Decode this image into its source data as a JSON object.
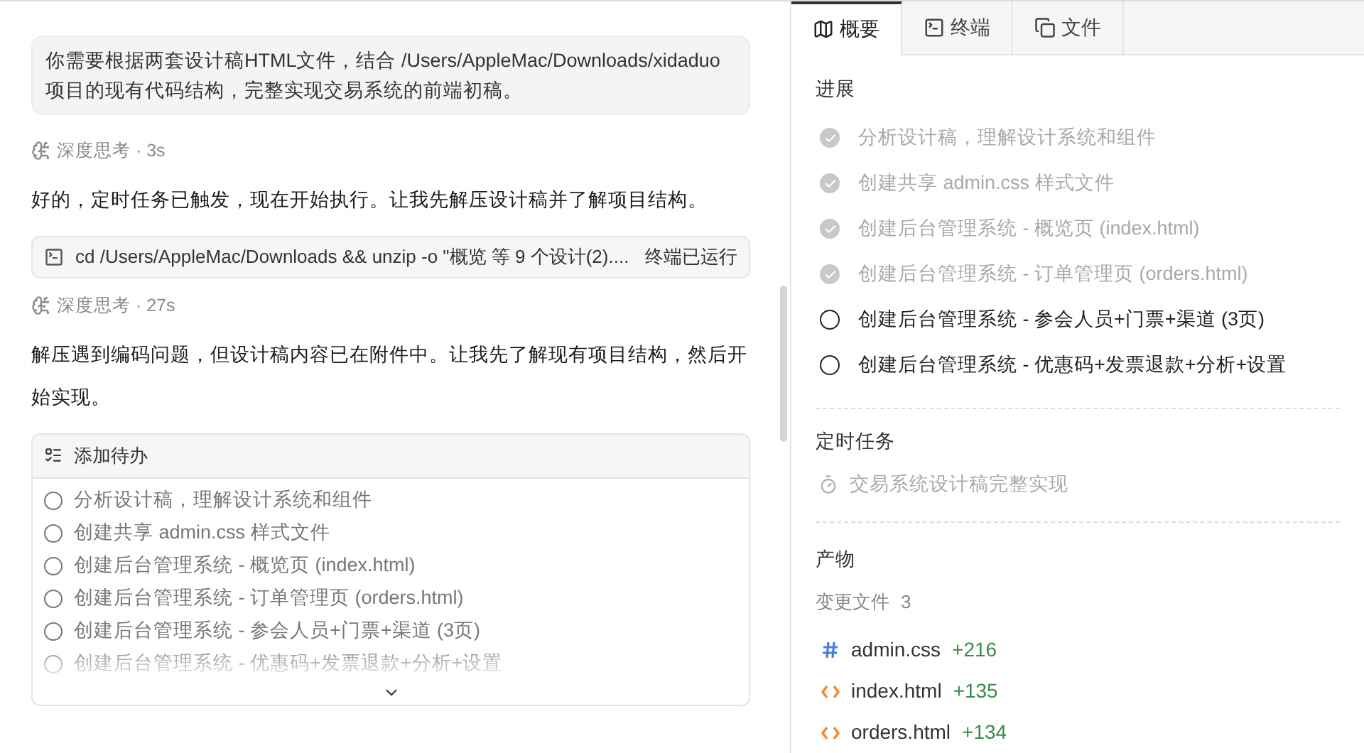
{
  "chat": {
    "user_message": "你需要根据两套设计稿HTML文件，结合 /Users/AppleMac/Downloads/xidaduo 项目的现有代码结构，完整实现交易系统的前端初稿。",
    "blocks": [
      {
        "kind": "thinking",
        "text": "深度思考 · 3s"
      },
      {
        "kind": "reply",
        "text": "好的，定时任务已触发，现在开始执行。让我先解压设计稿并了解项目结构。"
      },
      {
        "kind": "command",
        "text": "cd /Users/AppleMac/Downloads && unzip -o \"概览 等 9 个设计(2)....",
        "status": "终端已运行"
      },
      {
        "kind": "thinking",
        "text": "深度思考 · 27s"
      },
      {
        "kind": "reply",
        "text": "解压遇到编码问题，但设计稿内容已在附件中。让我先了解现有项目结构，然后开始实现。"
      }
    ],
    "todo": {
      "title": "添加待办",
      "items": [
        {
          "text": "分析设计稿，理解设计系统和组件",
          "checked": false
        },
        {
          "text": "创建共享 admin.css 样式文件",
          "checked": false
        },
        {
          "text": "创建后台管理系统 - 概览页 (index.html)",
          "checked": false
        },
        {
          "text": "创建后台管理系统 - 订单管理页 (orders.html)",
          "checked": false
        },
        {
          "text": "创建后台管理系统 - 参会人员+门票+渠道 (3页)",
          "checked": false
        },
        {
          "text": "创建后台管理系统 - 优惠码+发票退款+分析+设置",
          "checked": false
        }
      ]
    }
  },
  "tabs": [
    {
      "label": "概要",
      "kind": "map",
      "selected": true
    },
    {
      "label": "终端",
      "kind": "terminal",
      "selected": false
    },
    {
      "label": "文件",
      "kind": "file",
      "selected": false
    }
  ],
  "progress": {
    "title": "进展",
    "items": [
      {
        "text": "分析设计稿，理解设计系统和组件",
        "done": true
      },
      {
        "text": "创建共享 admin.css 样式文件",
        "done": true
      },
      {
        "text": "创建后台管理系统 - 概览页 (index.html)",
        "done": true
      },
      {
        "text": "创建后台管理系统 - 订单管理页 (orders.html)",
        "done": true
      },
      {
        "text": "创建后台管理系统 - 参会人员+门票+渠道 (3页)",
        "done": false
      },
      {
        "text": "创建后台管理系统 - 优惠码+发票退款+分析+设置",
        "done": false
      }
    ]
  },
  "scheduled": {
    "title": "定时任务",
    "items": [
      {
        "text": "交易系统设计稿完整实现"
      }
    ]
  },
  "artifacts": {
    "title": "产物",
    "changed_label": "变更文件",
    "changed_count": "3",
    "files": [
      {
        "name": "admin.css",
        "kind": "css",
        "added": "+216"
      },
      {
        "name": "index.html",
        "kind": "html",
        "added": "+135"
      },
      {
        "name": "orders.html",
        "kind": "html",
        "added": "+134"
      }
    ]
  }
}
